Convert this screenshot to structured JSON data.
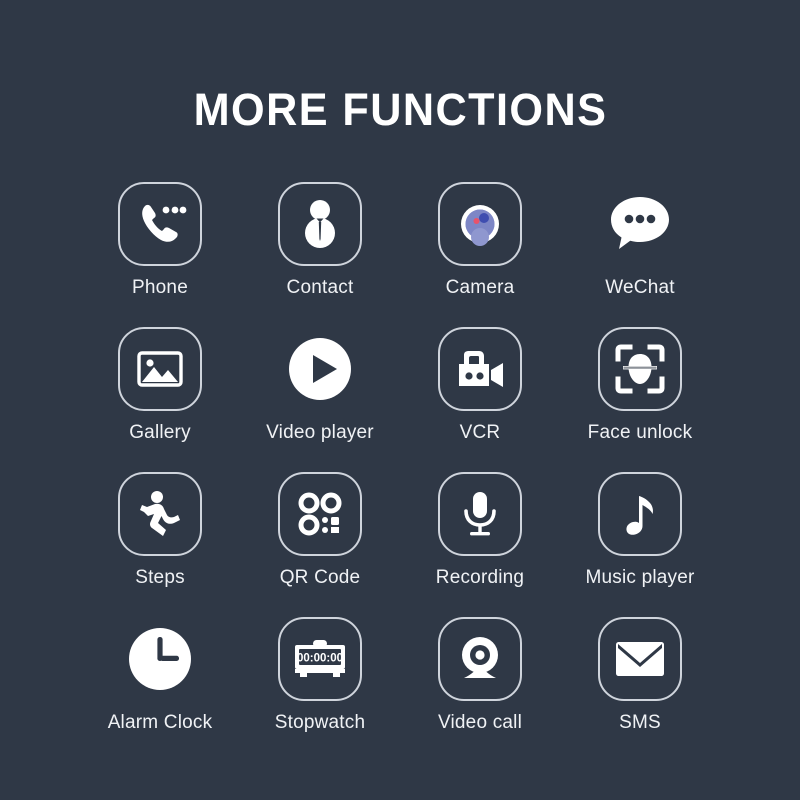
{
  "header": {
    "title": "MORE FUNCTIONS"
  },
  "colors": {
    "background": "#2f3846",
    "icon_stroke": "#cfd4dc",
    "icon_fill": "#ffffff",
    "label_text": "#f0f2f5",
    "camera_lens": "#7d86c6",
    "camera_lens_dark": "#3f4db0",
    "camera_lens_accent": "#e8536b"
  },
  "apps": [
    {
      "label": "Phone",
      "icon": "phone-icon"
    },
    {
      "label": "Contact",
      "icon": "contact-icon"
    },
    {
      "label": "Camera",
      "icon": "camera-icon"
    },
    {
      "label": "WeChat",
      "icon": "wechat-icon"
    },
    {
      "label": "Gallery",
      "icon": "gallery-icon"
    },
    {
      "label": "Video player",
      "icon": "video-player-icon"
    },
    {
      "label": "VCR",
      "icon": "vcr-icon"
    },
    {
      "label": "Face unlock",
      "icon": "face-unlock-icon"
    },
    {
      "label": "Steps",
      "icon": "steps-icon"
    },
    {
      "label": "QR Code",
      "icon": "qr-code-icon"
    },
    {
      "label": "Recording",
      "icon": "microphone-icon"
    },
    {
      "label": "Music player",
      "icon": "music-note-icon"
    },
    {
      "label": "Alarm Clock",
      "icon": "alarm-clock-icon"
    },
    {
      "label": "Stopwatch",
      "icon": "stopwatch-icon"
    },
    {
      "label": "Video call",
      "icon": "webcam-icon"
    },
    {
      "label": "SMS",
      "icon": "envelope-icon"
    }
  ],
  "stopwatch": {
    "display_value": "00:00:00"
  }
}
